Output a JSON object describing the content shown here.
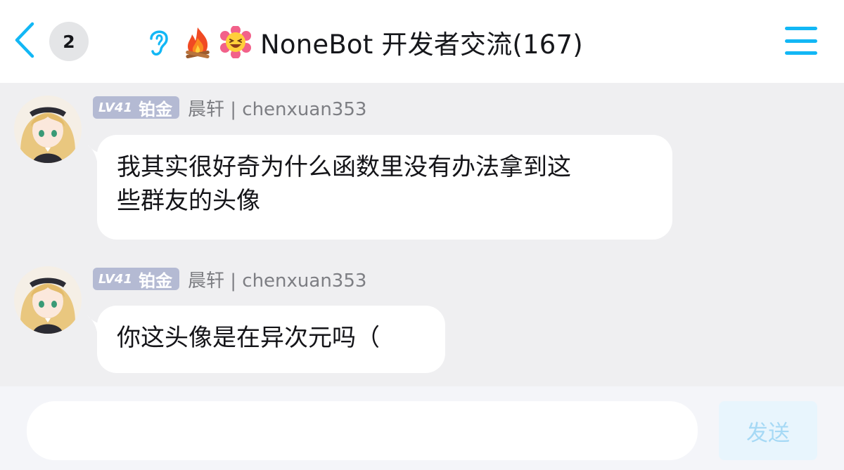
{
  "header": {
    "unread_count": "2",
    "title": "NoneBot 开发者交流(167)",
    "icons": [
      "back-chevron-icon",
      "ear-icon",
      "fire-emoji-icon",
      "grinning-flower-emoji-icon",
      "menu-icon"
    ]
  },
  "messages": [
    {
      "level": "LV41",
      "rank": "铂金",
      "sender": "晨轩 | chenxuan353",
      "text": "我其实很好奇为什么函数里没有办法拿到这\n些群友的头像"
    },
    {
      "level": "LV41",
      "rank": "铂金",
      "sender": "晨轩 | chenxuan353",
      "text": "你这头像是在异次元吗（"
    }
  ],
  "input": {
    "value": "",
    "send_label": "发送"
  },
  "colors": {
    "accent": "#12b7f5",
    "level_badge": "#b4bad3",
    "chat_background": "#efeff1"
  }
}
